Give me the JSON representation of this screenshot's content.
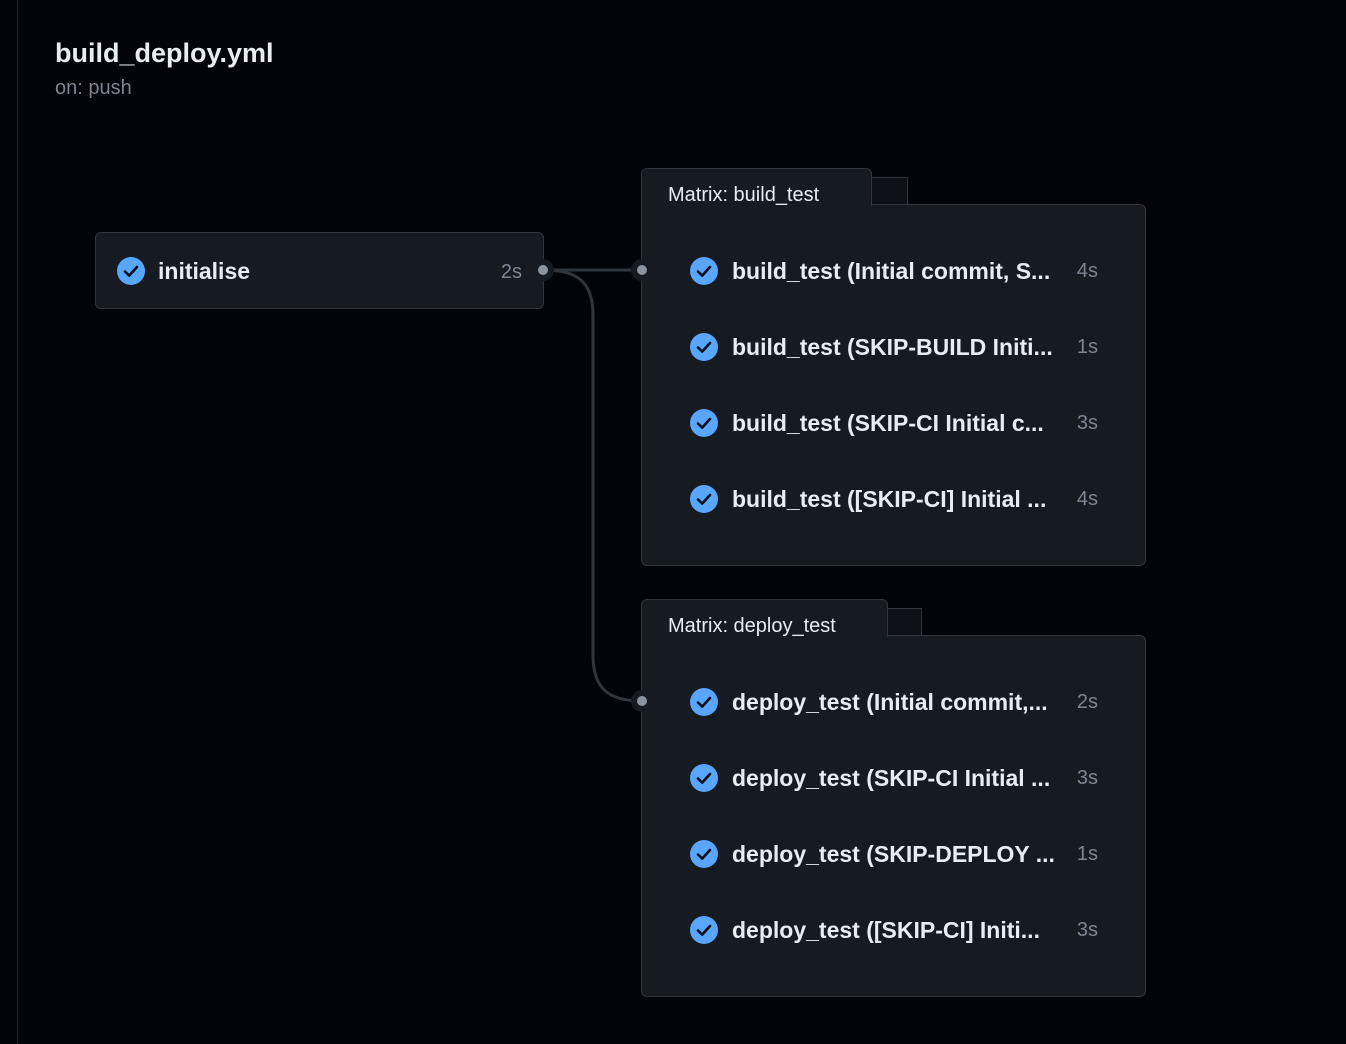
{
  "workflow": {
    "title": "build_deploy.yml",
    "trigger": "on: push"
  },
  "colors": {
    "background": "#010409",
    "card": "#161b22",
    "border": "#30363d",
    "success_icon": "#58a6ff",
    "muted_text": "#7d8590",
    "connector": "#30363d"
  },
  "icons": {
    "status": "check-circle-fill-icon"
  },
  "jobs": {
    "initialise": {
      "name": "initialise",
      "duration": "2s",
      "status": "success"
    }
  },
  "matrices": [
    {
      "title": "Matrix: build_test",
      "jobs": [
        {
          "label": "build_test (Initial commit, S...",
          "duration": "4s",
          "status": "success"
        },
        {
          "label": "build_test (SKIP-BUILD Initi...",
          "duration": "1s",
          "status": "success"
        },
        {
          "label": "build_test (SKIP-CI Initial c...",
          "duration": "3s",
          "status": "success"
        },
        {
          "label": "build_test ([SKIP-CI] Initial ...",
          "duration": "4s",
          "status": "success"
        }
      ]
    },
    {
      "title": "Matrix: deploy_test",
      "jobs": [
        {
          "label": "deploy_test (Initial commit,...",
          "duration": "2s",
          "status": "success"
        },
        {
          "label": "deploy_test (SKIP-CI Initial ...",
          "duration": "3s",
          "status": "success"
        },
        {
          "label": "deploy_test (SKIP-DEPLOY ...",
          "duration": "1s",
          "status": "success"
        },
        {
          "label": "deploy_test ([SKIP-CI] Initi...",
          "duration": "3s",
          "status": "success"
        }
      ]
    }
  ]
}
